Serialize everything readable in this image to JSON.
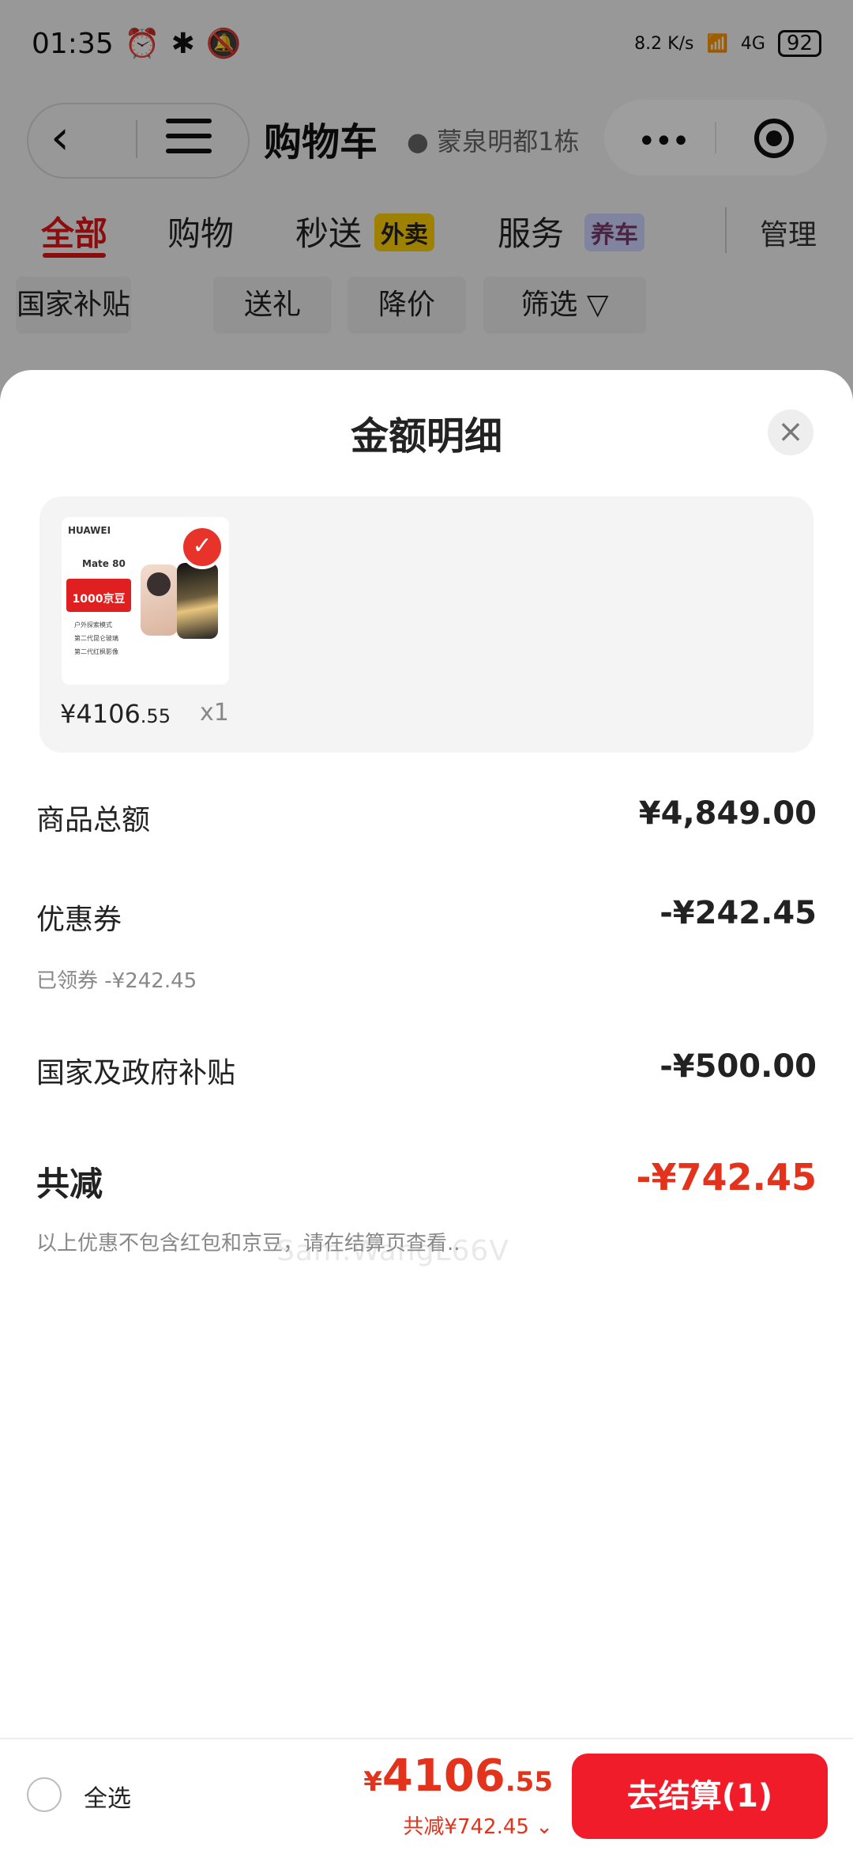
{
  "status_bar": {
    "time": "01:35",
    "icons": [
      "alarm-icon",
      "bluetooth-icon",
      "mute-icon"
    ],
    "net_speed": "8.2\nK/s",
    "signal": "4G",
    "battery": "92"
  },
  "nav": {
    "title": "购物车",
    "location": "蒙泉明都1栋"
  },
  "tabs": [
    {
      "label": "全部"
    },
    {
      "label": "购物"
    },
    {
      "label": "秒送",
      "badge": "外卖"
    },
    {
      "label": "服务",
      "badge": "养车"
    }
  ],
  "manage_label": "管理",
  "filter_chips": [
    "国家补贴",
    "送礼",
    "降价",
    "筛选"
  ],
  "sheet": {
    "title": "金额明细",
    "close_icon": "close-icon",
    "product": {
      "brand": "HUAWEI",
      "model": "Mate 80",
      "promo": "1000京豆",
      "features": [
        "户外探索模式",
        "第二代昆仑玻璃",
        "第二代红枫影像"
      ],
      "price_main": "¥4106",
      "price_decimal": ".55",
      "quantity": "x1",
      "checked": true
    },
    "rows": {
      "goods_total_label": "商品总额",
      "goods_total_value": "¥4,849.00",
      "coupon_label": "优惠券",
      "coupon_value": "-¥242.45",
      "coupon_sub": "已领券 -¥242.45",
      "subsidy_label": "国家及政府补贴",
      "subsidy_value": "-¥500.00",
      "total_label": "共减",
      "total_value": "-¥742.45",
      "note": "以上优惠不包含红包和京豆，请在结算页查看.."
    },
    "watermark": "Sam.WangL66V"
  },
  "bottom_bar": {
    "select_all": "全选",
    "price_yen": "¥",
    "price_int": "4106",
    "price_dec": ".55",
    "reduce_text": "共减¥742.45",
    "checkout_label": "去结算(1)"
  },
  "colors": {
    "accent_red": "#e4331d",
    "button_red": "#f01c2a",
    "badge_yellow": "#ffd100"
  }
}
